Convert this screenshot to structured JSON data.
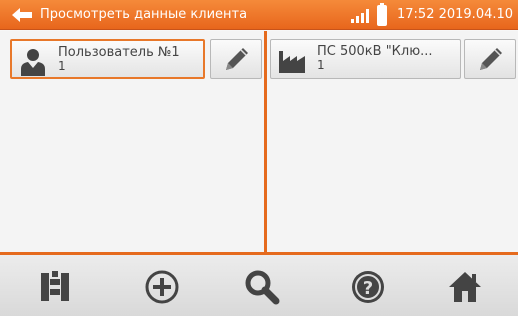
{
  "status_bar": {
    "title": "Просмотреть данные клиента",
    "datetime": "17:52 2019.04.10",
    "app_icon": "back-arrow-icon",
    "signal_icon": "signal-icon",
    "battery_icon": "battery-icon"
  },
  "left_panel": {
    "card": {
      "name": "Пользователь №1",
      "sub": "1",
      "icon": "person-icon"
    },
    "edit_icon": "pencil-icon"
  },
  "right_panel": {
    "card": {
      "name": "ПС 500кВ \"Клю...",
      "sub": "1",
      "icon": "factory-icon"
    },
    "edit_icon": "pencil-icon"
  },
  "toolbar": {
    "buttons": [
      "tree-icon",
      "add-icon",
      "search-icon",
      "help-icon",
      "home-icon"
    ]
  },
  "colors": {
    "accent": "#e8661c",
    "icon": "#444444"
  }
}
